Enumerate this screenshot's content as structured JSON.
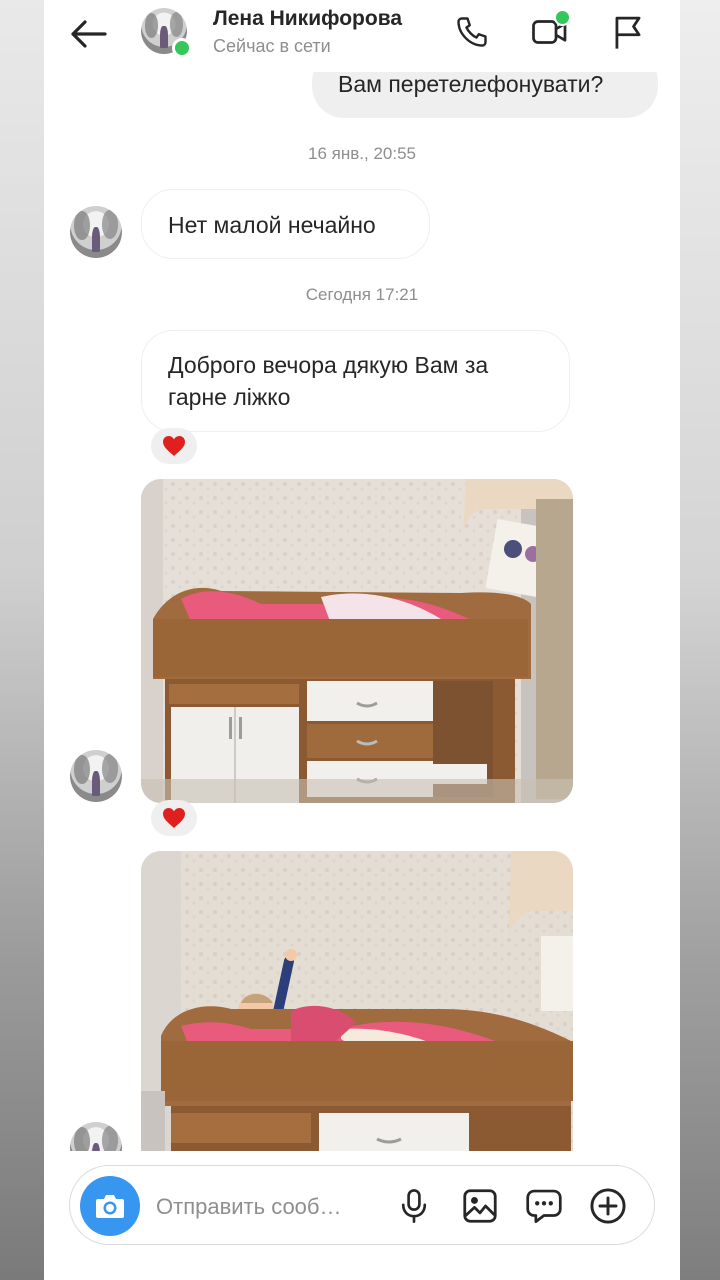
{
  "header": {
    "contact_name": "Лена Никифорова",
    "status": "Сейчас в сети",
    "online_color": "#34c759"
  },
  "messages": {
    "outgoing_partial": "Вам перетелефонувати?",
    "time_1": "16 янв., 20:55",
    "incoming_1": "Нет малой нечайно",
    "time_2": "Сегодня 17:21",
    "incoming_2": "Доброго вечора дякую Вам за гарне ліжко",
    "reaction_1": "❤️",
    "reaction_2": "❤️"
  },
  "photos": [
    {
      "subject": "Bunk bed with drawers and cabinet"
    },
    {
      "subject": "Child on bunk bed waving"
    }
  ],
  "composer": {
    "placeholder": "Отправить сооб…",
    "accent": "#3797f0"
  },
  "icons": [
    "back-arrow-icon",
    "phone-icon",
    "video-icon",
    "flag-icon",
    "camera-icon",
    "microphone-icon",
    "gallery-icon",
    "sticker-icon",
    "plus-icon",
    "heart-icon"
  ]
}
